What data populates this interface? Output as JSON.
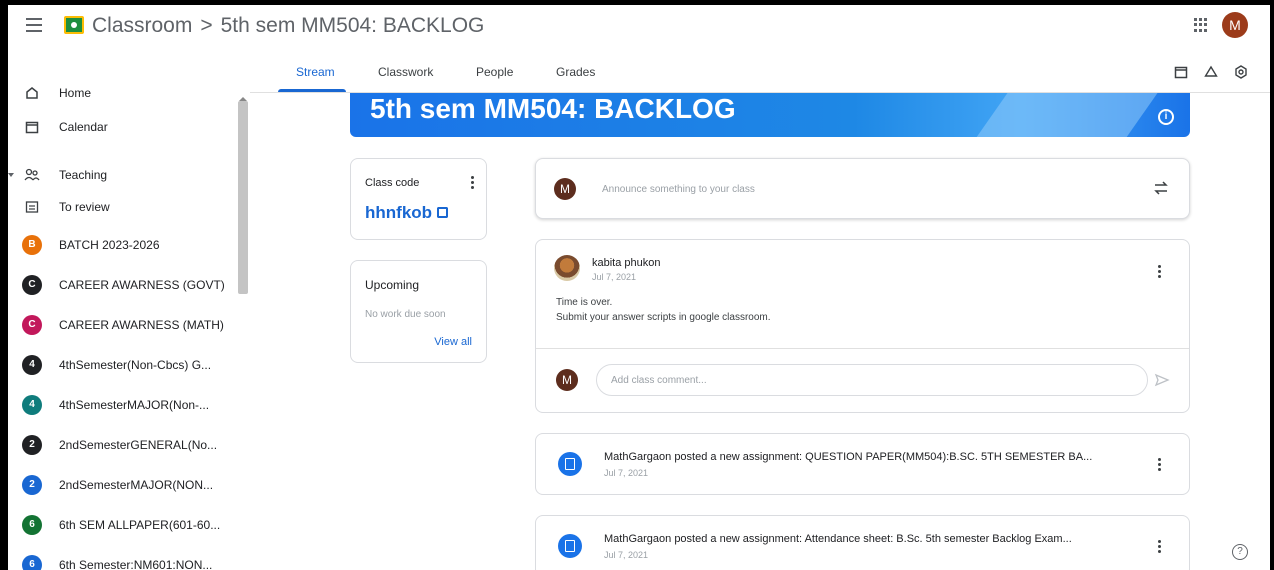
{
  "header": {
    "app_name": "Classroom",
    "separator": ">",
    "class_name": "5th sem MM504: BACKLOG",
    "user_initial": "M"
  },
  "sidebar": {
    "items": [
      {
        "label": "Home",
        "icon": "home-icon"
      },
      {
        "label": "Calendar",
        "icon": "calendar-icon"
      },
      {
        "label": "Teaching",
        "icon": "people-icon"
      },
      {
        "label": "To review",
        "icon": "review-icon"
      },
      {
        "label": "BATCH 2023-2026",
        "initial": "B",
        "color": "#e8710a"
      },
      {
        "label": "CAREER AWARNESS (GOVT)",
        "initial": "C",
        "color": "#202124"
      },
      {
        "label": "CAREER AWARNESS (MATH)",
        "initial": "C",
        "color": "#c2185b"
      },
      {
        "label": "4thSemester(Non-Cbcs) G...",
        "initial": "4",
        "color": "#202124"
      },
      {
        "label": "4thSemesterMAJOR(Non-...",
        "initial": "4",
        "color": "#0f7c7c"
      },
      {
        "label": "2ndSemesterGENERAL(No...",
        "initial": "2",
        "color": "#202124"
      },
      {
        "label": "2ndSemesterMAJOR(NON...",
        "initial": "2",
        "color": "#1967d2"
      },
      {
        "label": "6th SEM ALLPAPER(601-60...",
        "initial": "6",
        "color": "#137333"
      },
      {
        "label": "6th Semester:NM601:NON...",
        "initial": "6",
        "color": "#1967d2"
      }
    ]
  },
  "tabs": [
    {
      "label": "Stream"
    },
    {
      "label": "Classwork"
    },
    {
      "label": "People"
    },
    {
      "label": "Grades"
    }
  ],
  "banner": {
    "title": "5th sem MM504: BACKLOG"
  },
  "class_code": {
    "label": "Class code",
    "code": "hhnfkob"
  },
  "upcoming": {
    "title": "Upcoming",
    "empty_text": "No work due soon",
    "view_all": "View all"
  },
  "announce": {
    "avatar_initial": "M",
    "placeholder": "Announce something to your class"
  },
  "post": {
    "author": "kabita phukon",
    "date": "Jul 7, 2021",
    "line1": "Time is over.",
    "line2": "Submit your answer scripts in google classroom.",
    "comment_avatar": "M",
    "comment_placeholder": "Add class comment..."
  },
  "assignments": [
    {
      "text": "MathGargaon posted a new assignment: QUESTION PAPER(MM504):B.SC. 5TH SEMESTER BA...",
      "date": "Jul 7, 2021"
    },
    {
      "text": "MathGargaon posted a new assignment: Attendance sheet: B.Sc. 5th semester Backlog Exam...",
      "date": "Jul 7, 2021"
    }
  ],
  "colors": {
    "primary": "#1967d2",
    "banner": "#1a73e8"
  }
}
